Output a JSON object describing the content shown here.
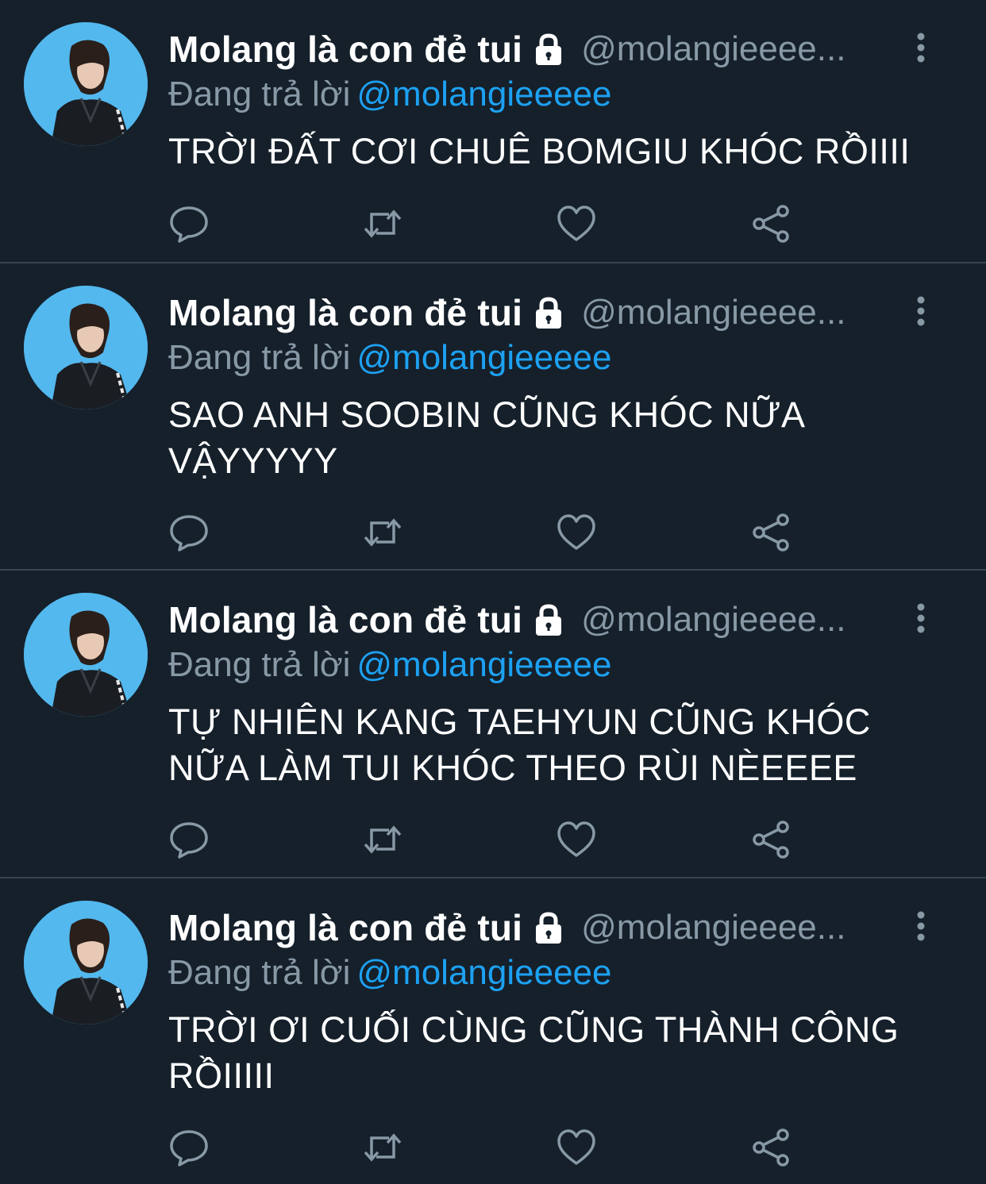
{
  "theme": {
    "background": "#15202b",
    "divider": "#38444d",
    "secondary_text": "#8899a6",
    "accent": "#1da1f2",
    "avatar_bg": "#53b8ee"
  },
  "tweets": [
    {
      "display_name": "Molang là con đẻ tui",
      "handle": "@molangieeee...",
      "replying_prefix": "Đang trả lời",
      "replying_to": "@molangieeeee",
      "text": "TRỜI ĐẤT CƠI CHUÊ BOMGIU KHÓC RỒIIII"
    },
    {
      "display_name": "Molang là con đẻ tui",
      "handle": "@molangieeee...",
      "replying_prefix": "Đang trả lời",
      "replying_to": "@molangieeeee",
      "text": "SAO ANH SOOBIN CŨNG KHÓC NỮA VẬYYYYY"
    },
    {
      "display_name": "Molang là con đẻ tui",
      "handle": "@molangieeee...",
      "replying_prefix": "Đang trả lời",
      "replying_to": "@molangieeeee",
      "text": "TỰ NHIÊN KANG TAEHYUN CŨNG KHÓC NỮA LÀM TUI KHÓC THEO RÙI NÈEEEE"
    },
    {
      "display_name": "Molang là con đẻ tui",
      "handle": "@molangieeee...",
      "replying_prefix": "Đang trả lời",
      "replying_to": "@molangieeeee",
      "text": "TRỜI ƠI CUỐI CÙNG CŨNG THÀNH CÔNG RỒIIIII"
    }
  ],
  "icons": {
    "protected": "lock-icon",
    "more": "more-vertical-icon",
    "reply": "reply-icon",
    "retweet": "retweet-icon",
    "like": "heart-icon",
    "share": "share-icon"
  }
}
